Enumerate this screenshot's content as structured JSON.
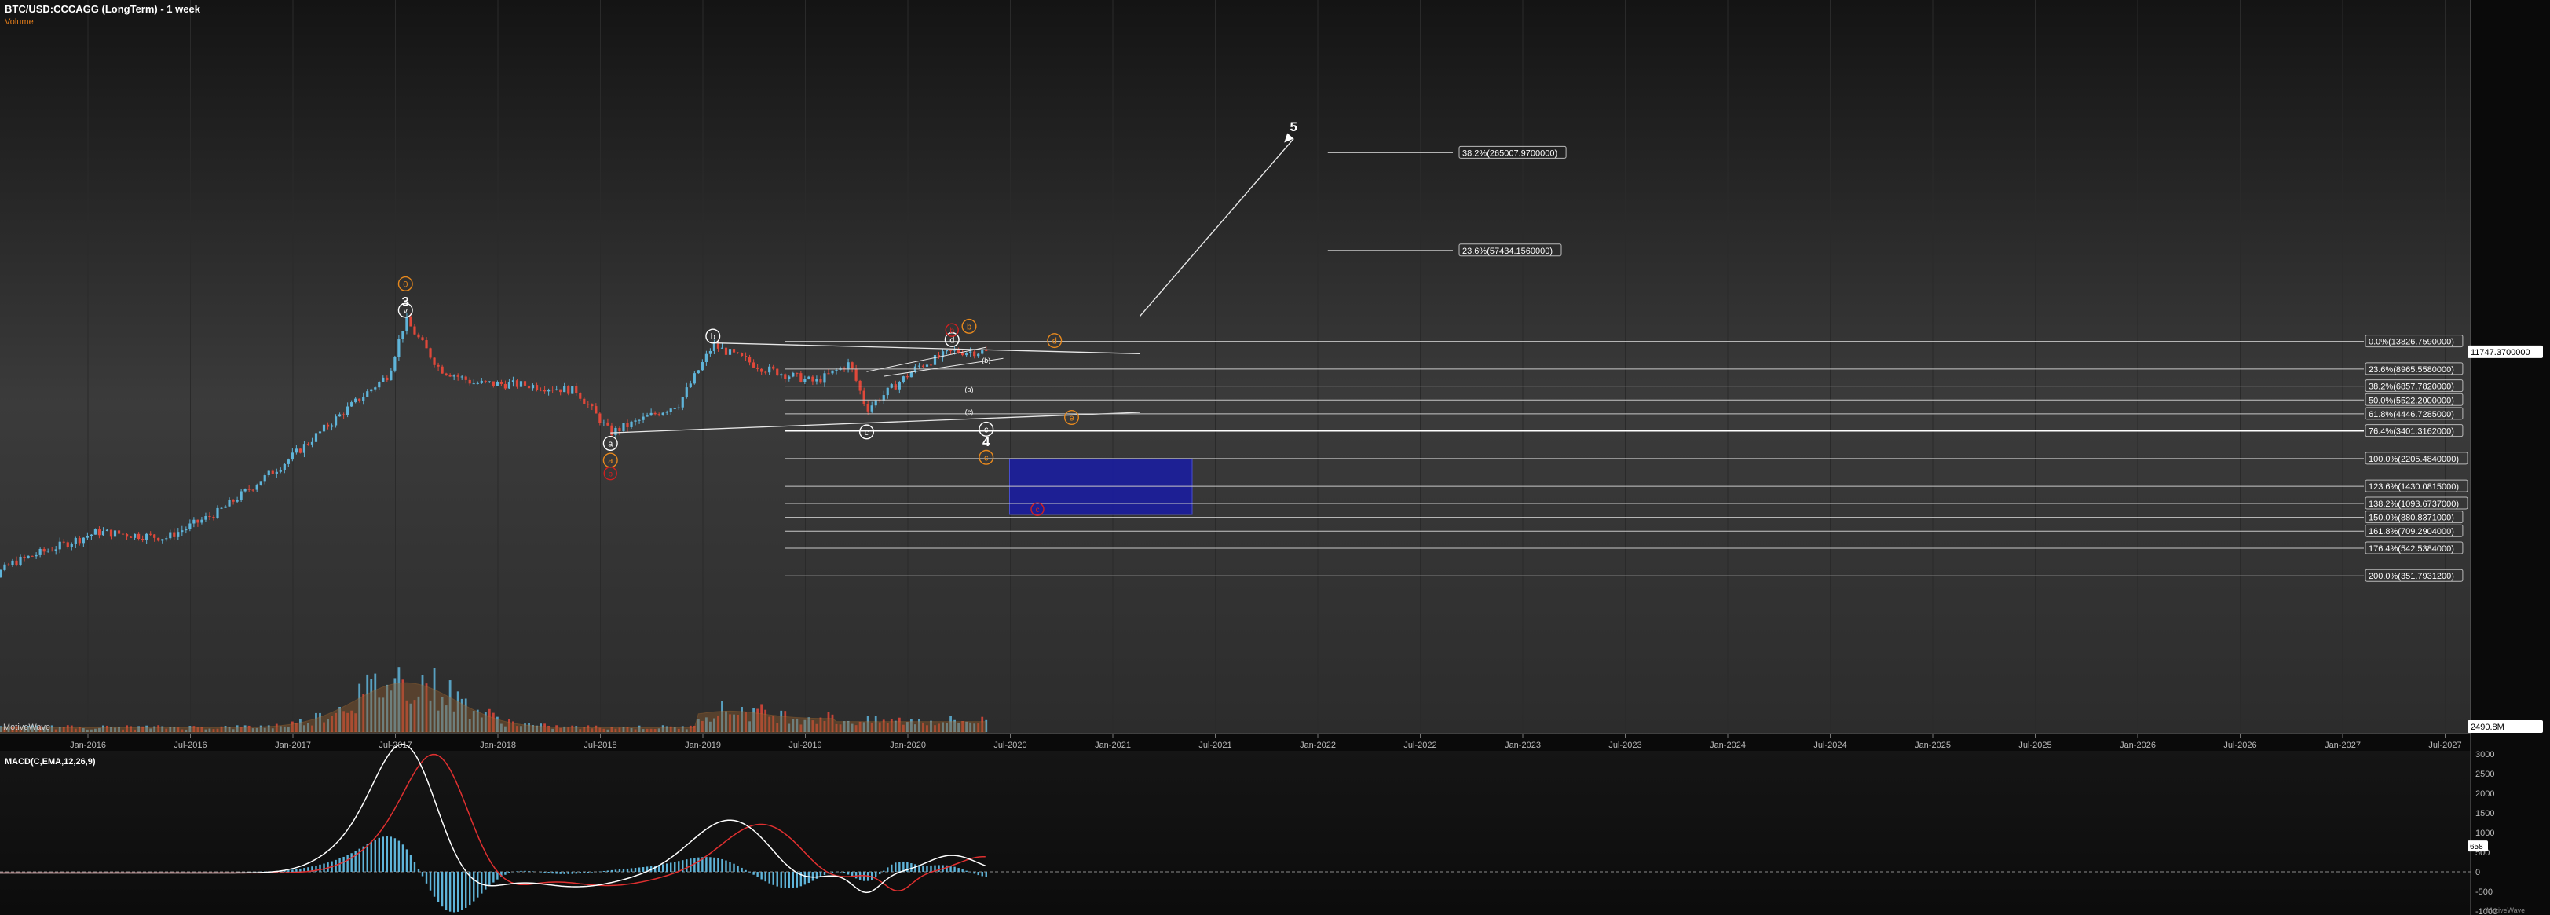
{
  "window": {
    "title": "BTC/USD:CCCAGG (LongTerm) - 1 week",
    "subtitle": "Volume",
    "indicator_label": "MotiveWave",
    "macd_title": "MACD(C,EMA,12,26,9)",
    "watermark": "MotiveWave"
  },
  "colors": {
    "background": "#0b0b0b",
    "up_candle": "#5fb4d9",
    "down_candle": "#e0483a",
    "fib_line": "#c8c8c8",
    "wave_orange": "#e8891d",
    "wave_red": "#d02020",
    "target_box": "#1b1e9c",
    "volume_area": "#8a5a2e",
    "macd_line": "#ffffff",
    "signal_line": "#e03030",
    "histogram": "#5fb4d9"
  },
  "chart_data": {
    "type": "candlestick",
    "symbol": "BTC/USD:CCCAGG",
    "timeframe": "1 week",
    "x_axis_labels": [
      "Jan-2016",
      "Jul-2016",
      "Jan-2017",
      "Jul-2017",
      "Jan-2018",
      "Jul-2018",
      "Jan-2019",
      "Jul-2019",
      "Jan-2020",
      "Jul-2020",
      "Jan-2021",
      "Jul-2021",
      "Jan-2022",
      "Jul-2022",
      "Jan-2023",
      "Jul-2023",
      "Jan-2024",
      "Jul-2024",
      "Jan-2025",
      "Jul-2025",
      "Jan-2026",
      "Jul-2026",
      "Jan-2027",
      "Jul-2027"
    ],
    "y_scale": "log",
    "current_price": "11747.3700000",
    "volume_label": "2490.8M",
    "price_path": [
      {
        "date": "2015-10",
        "price": 240
      },
      {
        "date": "2016-01",
        "price": 430
      },
      {
        "date": "2016-06",
        "price": 700
      },
      {
        "date": "2016-10",
        "price": 640
      },
      {
        "date": "2017-01",
        "price": 950
      },
      {
        "date": "2017-05",
        "price": 2100
      },
      {
        "date": "2017-08",
        "price": 4200
      },
      {
        "date": "2017-11",
        "price": 8200
      },
      {
        "date": "2017-12",
        "price": 19500
      },
      {
        "date": "2018-02",
        "price": 9000
      },
      {
        "date": "2018-04",
        "price": 7200
      },
      {
        "date": "2018-07",
        "price": 7000
      },
      {
        "date": "2018-10",
        "price": 6400
      },
      {
        "date": "2018-12",
        "price": 3300
      },
      {
        "date": "2019-04",
        "price": 5200
      },
      {
        "date": "2019-06",
        "price": 13000
      },
      {
        "date": "2019-09",
        "price": 9000
      },
      {
        "date": "2019-12",
        "price": 7300
      },
      {
        "date": "2020-02",
        "price": 9800
      },
      {
        "date": "2020-03",
        "price": 4800
      },
      {
        "date": "2020-06",
        "price": 9300
      },
      {
        "date": "2020-08",
        "price": 11800
      },
      {
        "date": "2020-10",
        "price": 11747
      }
    ],
    "fib_levels": [
      {
        "label": "38.2%(265007.9700000)",
        "value": 265007.97
      },
      {
        "label": "23.6%(57434.1560000)",
        "value": 57434.156
      },
      {
        "label": "0.0%(13826.7590000)",
        "value": 13826.759
      },
      {
        "label": "23.6%(8965.5580000)",
        "value": 8965.558
      },
      {
        "label": "38.2%(6857.7820000)",
        "value": 6857.782
      },
      {
        "label": "50.0%(5522.2000000)",
        "value": 5522.2
      },
      {
        "label": "61.8%(4446.7285000)",
        "value": 4446.7285
      },
      {
        "label": "76.4%(3401.3162000)",
        "value": 3401.3162
      },
      {
        "label": "100.0%(2205.4840000)",
        "value": 2205.484
      },
      {
        "label": "123.6%(1430.0815000)",
        "value": 1430.0815
      },
      {
        "label": "138.2%(1093.6737000)",
        "value": 1093.6737
      },
      {
        "label": "150.0%(880.8371000)",
        "value": 880.8371
      },
      {
        "label": "161.8%(709.2904000)",
        "value": 709.2904
      },
      {
        "label": "176.4%(542.5384000)",
        "value": 542.5384
      },
      {
        "label": "200.0%(351.7931200)",
        "value": 351.79312
      }
    ],
    "wave_labels": [
      {
        "text": "3",
        "date": "2017-12",
        "price": 26000,
        "style": "white-plain"
      },
      {
        "text": "0",
        "date": "2017-12",
        "price": 34000,
        "style": "orange-circle"
      },
      {
        "text": "v",
        "date": "2017-12",
        "price": 22500,
        "style": "white-circle"
      },
      {
        "text": "a",
        "date": "2018-12",
        "price": 2800,
        "style": "white-circle"
      },
      {
        "text": "a",
        "date": "2018-12",
        "price": 2150,
        "style": "orange-circle"
      },
      {
        "text": "b",
        "date": "2018-12",
        "price": 1750,
        "style": "red-circle"
      },
      {
        "text": "b",
        "date": "2019-06",
        "price": 15000,
        "style": "white-circle"
      },
      {
        "text": "c",
        "date": "2020-03",
        "price": 3350,
        "style": "white-circle"
      },
      {
        "text": "d",
        "date": "2020-08",
        "price": 14200,
        "style": "white-circle"
      },
      {
        "text": "b",
        "date": "2020-08",
        "price": 16500,
        "style": "red-circle"
      },
      {
        "text": "b",
        "date": "2020-09",
        "price": 17500,
        "style": "orange-circle"
      },
      {
        "text": "d",
        "date": "2021-02",
        "price": 14000,
        "style": "orange-circle"
      },
      {
        "text": "e",
        "date": "2021-03",
        "price": 4200,
        "style": "orange-circle"
      },
      {
        "text": "(b)",
        "date": "2020-10",
        "price": 10300,
        "style": "white-small"
      },
      {
        "text": "(a)",
        "date": "2020-09",
        "price": 6500,
        "style": "white-small"
      },
      {
        "text": "(c)",
        "date": "2020-09",
        "price": 4600,
        "style": "white-small"
      },
      {
        "text": "c",
        "date": "2020-10",
        "price": 3500,
        "style": "white-circle"
      },
      {
        "text": "4",
        "date": "2020-10",
        "price": 2900,
        "style": "white-plain"
      },
      {
        "text": "c",
        "date": "2020-10",
        "price": 2250,
        "style": "orange-circle"
      },
      {
        "text": "c",
        "date": "2021-01",
        "price": 1000,
        "style": "red-circle"
      },
      {
        "text": "5",
        "date": "2022-04",
        "price": 400000,
        "style": "white-plain"
      }
    ],
    "macd": {
      "title": "MACD(C,EMA,12,26,9)",
      "y_ticks": [
        3000,
        2500,
        2000,
        1500,
        1000,
        500,
        0,
        -500,
        -1000
      ],
      "current_value": "658",
      "x_end": "2020-10"
    }
  }
}
